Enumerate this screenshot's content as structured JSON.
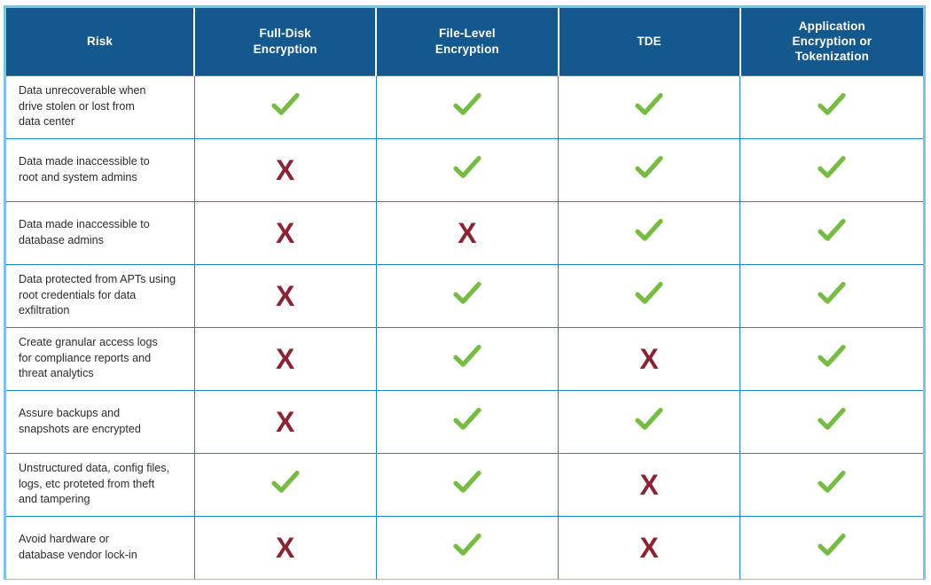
{
  "table": {
    "columns": [
      {
        "key": "risk",
        "label_lines": [
          "Risk"
        ]
      },
      {
        "key": "fde",
        "label_lines": [
          "Full-Disk",
          "Encryption"
        ]
      },
      {
        "key": "fle",
        "label_lines": [
          "File-Level",
          "Encryption"
        ]
      },
      {
        "key": "tde",
        "label_lines": [
          "TDE"
        ]
      },
      {
        "key": "appenc",
        "label_lines": [
          "Application",
          "Encryption or",
          "Tokenization"
        ]
      }
    ],
    "colors": {
      "header_bg": "#13598e",
      "header_text": "#ffffff",
      "grid_line": "#1887c9",
      "outer_border": "#7ec2e6",
      "check": "#76bc43",
      "cross": "#8c2332",
      "body_text": "#2b2b2b",
      "body_bg": "#ffffff"
    },
    "marks": {
      "yes": "check-icon",
      "no": "cross-icon"
    },
    "rows": [
      {
        "risk_lines": [
          "Data unrecoverable when",
          "drive stolen or lost from",
          "data center"
        ],
        "values": [
          "yes",
          "yes",
          "yes",
          "yes"
        ]
      },
      {
        "risk_lines": [
          "Data made inaccessible to",
          "root and system admins"
        ],
        "values": [
          "no",
          "yes",
          "yes",
          "yes"
        ]
      },
      {
        "risk_lines": [
          "Data made inaccessible to",
          "database admins"
        ],
        "values": [
          "no",
          "no",
          "yes",
          "yes"
        ]
      },
      {
        "risk_lines": [
          "Data protected from APTs using",
          "root credentials for data exfiltration"
        ],
        "values": [
          "no",
          "yes",
          "yes",
          "yes"
        ]
      },
      {
        "risk_lines": [
          "Create granular access logs",
          "for compliance reports and",
          "threat analytics"
        ],
        "values": [
          "no",
          "yes",
          "no",
          "yes"
        ]
      },
      {
        "risk_lines": [
          "Assure backups and",
          "snapshots are encrypted"
        ],
        "values": [
          "no",
          "yes",
          "yes",
          "yes"
        ]
      },
      {
        "risk_lines": [
          "Unstructured data, config files,",
          "logs, etc proteted from theft",
          "and tampering"
        ],
        "values": [
          "yes",
          "yes",
          "no",
          "yes"
        ]
      },
      {
        "risk_lines": [
          "Avoid hardware or",
          "database vendor lock-in"
        ],
        "values": [
          "no",
          "yes",
          "no",
          "yes"
        ]
      }
    ]
  }
}
